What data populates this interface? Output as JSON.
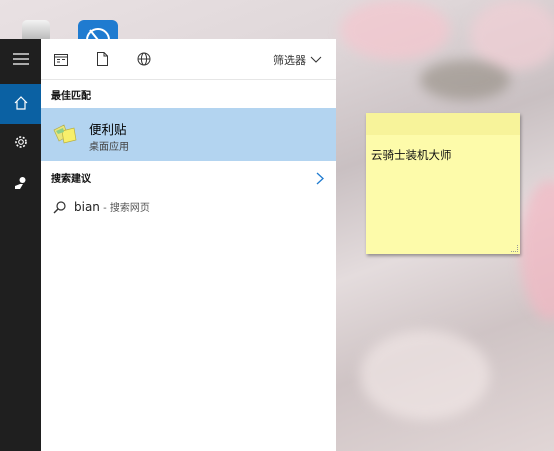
{
  "desktop": {
    "icons": [
      "settings-app-icon",
      "network-app-icon"
    ]
  },
  "sidebar": {
    "items": [
      {
        "name": "menu",
        "icon": "hamburger-icon"
      },
      {
        "name": "home",
        "icon": "home-icon",
        "active": true
      },
      {
        "name": "settings",
        "icon": "gear-icon"
      },
      {
        "name": "feedback",
        "icon": "feedback-icon"
      }
    ]
  },
  "search_panel": {
    "toolbar": {
      "icons": [
        "apps-icon",
        "document-icon",
        "web-globe-icon"
      ],
      "filter_label": "筛选器"
    },
    "best_match": {
      "heading": "最佳匹配",
      "item_name": "便利贴",
      "item_sub": "桌面应用"
    },
    "suggestions": {
      "heading": "搜索建议",
      "query": "bian",
      "hint": " - 搜索网页"
    }
  },
  "sticky_note": {
    "text": "云骑士装机大师"
  }
}
